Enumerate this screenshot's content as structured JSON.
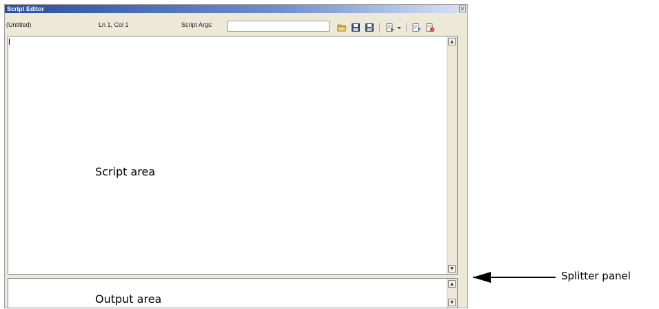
{
  "window": {
    "title": "Script Editor",
    "close_glyph": "×"
  },
  "toolbar": {
    "filename": "(Untitled)",
    "cursor_position": "Ln 1, Col 1",
    "script_args_label": "Script Args:",
    "script_args_value": "",
    "icons": [
      "open-folder-icon",
      "save-icon",
      "save-as-icon",
      "run-script-icon",
      "dropdown-arrow-icon",
      "run-step-icon",
      "stop-icon"
    ]
  },
  "script_area": {
    "label": "Script area"
  },
  "output_area": {
    "label": "Output area"
  },
  "annotation": {
    "splitter_label": "Splitter panel"
  },
  "colors": {
    "title_bar_start": "#2a4ea0",
    "title_bar_end": "#dbe4f4",
    "window_background": "#ece9d8",
    "folder_icon": "#e0b84a",
    "save_icon": "#3a4e78"
  }
}
